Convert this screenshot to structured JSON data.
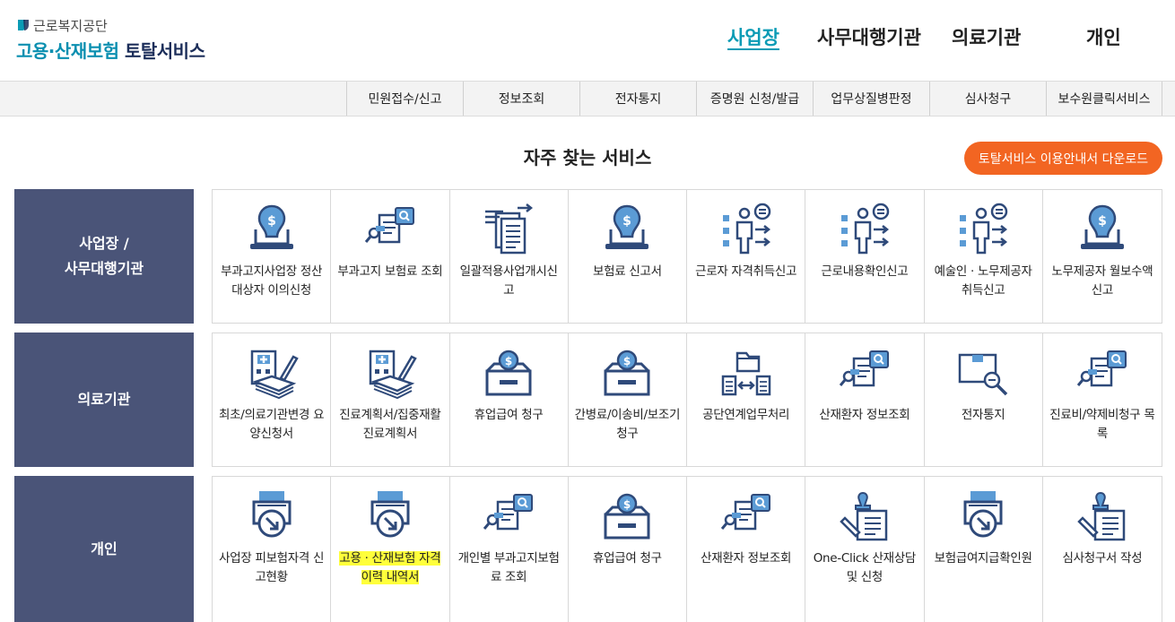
{
  "header": {
    "org_name": "근로복지공단",
    "service_name_part1": "고용·산재보험",
    "service_name_part2": "토탈서비스",
    "gnb": [
      "사업장",
      "사무대행기관",
      "의료기관",
      "개인"
    ]
  },
  "subnav": [
    "민원접수/신고",
    "정보조회",
    "전자통지",
    "증명원 신청/발급",
    "업무상질병판정",
    "심사청구",
    "보수원클릭서비스"
  ],
  "section": {
    "title": "자주 찾는 서비스",
    "download_button": "토탈서비스 이용안내서 다운로드"
  },
  "rows": [
    {
      "label_line1": "사업장 /",
      "label_line2": "사무대행기관",
      "items": [
        {
          "label": "부과고지사업장 정산대상자 이의신청",
          "icon": "money-laptop-icon"
        },
        {
          "label": "부과고지 보험료 조회",
          "icon": "document-search-icon"
        },
        {
          "label": "일괄적용사업개시신고",
          "icon": "document-stack-icon"
        },
        {
          "label": "보험료 신고서",
          "icon": "money-laptop-icon"
        },
        {
          "label": "근로자 자격취득신고",
          "icon": "worker-checklist-icon"
        },
        {
          "label": "근로내용확인신고",
          "icon": "worker-checklist-icon"
        },
        {
          "label": "예술인 · 노무제공자 취득신고",
          "icon": "worker-checklist-icon"
        },
        {
          "label": "노무제공자 월보수액 신고",
          "icon": "money-laptop-icon"
        }
      ]
    },
    {
      "label_line1": "의료기관",
      "label_line2": "",
      "items": [
        {
          "label": "최초/의료기관변경 요양신청서",
          "icon": "hospital-pen-icon"
        },
        {
          "label": "진료계획서/집중재활진료계획서",
          "icon": "hospital-pen-icon"
        },
        {
          "label": "휴업급여 청구",
          "icon": "money-box-icon"
        },
        {
          "label": "간병료/이송비/보조기 청구",
          "icon": "money-box-icon"
        },
        {
          "label": "공단연계업무처리",
          "icon": "folder-exchange-icon"
        },
        {
          "label": "산재환자 정보조회",
          "icon": "document-search-icon"
        },
        {
          "label": "전자통지",
          "icon": "box-magnifier-icon"
        },
        {
          "label": "진료비/약제비청구 목록",
          "icon": "document-search-icon"
        }
      ]
    },
    {
      "label_line1": "개인",
      "label_line2": "",
      "items": [
        {
          "label": "사업장 피보험자격 신고현황",
          "icon": "printer-download-icon"
        },
        {
          "label": "고용 · 산재보험 자격 이력 내역서",
          "icon": "printer-download-icon",
          "highlighted": true
        },
        {
          "label": "개인별 부과고지보험료 조회",
          "icon": "document-search-icon"
        },
        {
          "label": "휴업급여 청구",
          "icon": "money-box-icon"
        },
        {
          "label": "산재환자 정보조회",
          "icon": "document-search-icon"
        },
        {
          "label": "One-Click 산재상담 및 신청",
          "icon": "stamp-document-icon"
        },
        {
          "label": "보험급여지급확인원",
          "icon": "printer-download-icon"
        },
        {
          "label": "심사청구서 작성",
          "icon": "stamp-document-icon"
        }
      ]
    }
  ],
  "colors": {
    "accent": "#0a9bb5",
    "row_label_bg": "#4a5478",
    "download_button": "#f26522",
    "icon_dark": "#2f4a7a",
    "icon_light": "#5b9bd5",
    "highlight": "#ffff3b"
  }
}
